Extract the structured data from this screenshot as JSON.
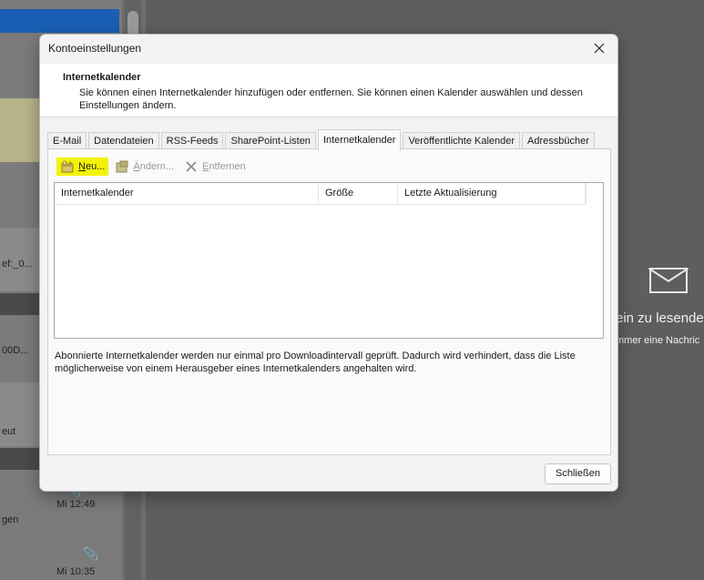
{
  "background": {
    "list_texts": [
      "ef:_0...",
      "00D...",
      "eut",
      "Mi 12:49",
      "gen",
      "Mi 10:35"
    ],
    "reading_title": "ein zu lesende",
    "reading_sub": "mmer eine Nachric"
  },
  "dialog": {
    "title": "Kontoeinstellungen",
    "header_title": "Internetkalender",
    "header_desc": "Sie können einen Internetkalender hinzufügen oder entfernen. Sie können einen Kalender auswählen und dessen Einstellungen ändern.",
    "tabs": [
      {
        "label": "E-Mail"
      },
      {
        "label": "Datendateien"
      },
      {
        "label": "RSS-Feeds"
      },
      {
        "label": "SharePoint-Listen"
      },
      {
        "label": "Internetkalender",
        "active": true
      },
      {
        "label": "Veröffentlichte Kalender"
      },
      {
        "label": "Adressbücher"
      }
    ],
    "toolbar": {
      "new_label": "Neu...",
      "change_label": "Ändern...",
      "remove_label": "Entfernen"
    },
    "columns": [
      "Internetkalender",
      "Größe",
      "Letzte Aktualisierung"
    ],
    "note": "Abonnierte Internetkalender werden nur einmal pro Downloadintervall geprüft. Dadurch wird verhindert, dass die Liste möglicherweise von einem Herausgeber eines Internetkalenders angehalten wird.",
    "close_button": "Schließen"
  },
  "colors": {
    "highlight": "#f3f30a",
    "accent_blue": "#1a5fb4"
  }
}
